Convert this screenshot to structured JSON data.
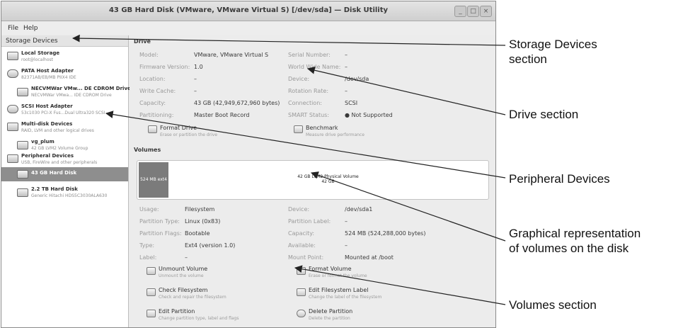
{
  "window": {
    "title": "43 GB Hard Disk (VMware, VMware Virtual S) [/dev/sda] — Disk Utility",
    "buttons": {
      "minimize": "_",
      "maximize": "□",
      "close": "×"
    }
  },
  "menubar": {
    "file": "File",
    "help": "Help"
  },
  "sidebar": {
    "header": "Storage Devices",
    "items": [
      {
        "title": "Local Storage",
        "subtitle": "root@localhost",
        "icon": "computer-icon"
      },
      {
        "title": "PATA Host Adapter",
        "subtitle": "82371AB/EB/MB PIIX4 IDE",
        "icon": "adapter-icon"
      },
      {
        "title": "NECVMWar VMw... DE CDROM Drive",
        "subtitle": "NECVMWar VMwa... IDE CDROM Drive",
        "icon": "optical-drive-icon"
      },
      {
        "title": "SCSI Host Adapter",
        "subtitle": "53c1030 PCI-X Fus...Dual Ultra320 SCSI",
        "icon": "adapter-icon"
      },
      {
        "title": "Multi-disk Devices",
        "subtitle": "RAID, LVM and other logical drives",
        "icon": "multidisk-icon"
      },
      {
        "title": "vg_plum",
        "subtitle": "42 GB LVM2 Volume Group",
        "icon": "volume-group-icon"
      },
      {
        "title": "Peripheral Devices",
        "subtitle": "USB, FireWire and other peripherals",
        "icon": "peripheral-icon"
      },
      {
        "title": "43 GB Hard Disk",
        "subtitle": "",
        "icon": "hard-disk-icon"
      },
      {
        "title": "2.2 TB Hard Disk",
        "subtitle": "Generic Hitachi HDS5C3030ALA630",
        "icon": "hard-disk-icon"
      }
    ]
  },
  "drive": {
    "heading": "Drive",
    "model_label": "Model:",
    "model": "VMware, VMware Virtual S",
    "firmware_label": "Firmware Version:",
    "firmware": "1.0",
    "location_label": "Location:",
    "location": "–",
    "write_cache_label": "Write Cache:",
    "write_cache": "–",
    "capacity_label": "Capacity:",
    "capacity": "43 GB (42,949,672,960 bytes)",
    "partitioning_label": "Partitioning:",
    "partitioning": "Master Boot Record",
    "serial_label": "Serial Number:",
    "serial": "–",
    "wwn_label": "World Wide Name:",
    "wwn": "–",
    "device_label": "Device:",
    "device": "/dev/sda",
    "rotation_label": "Rotation Rate:",
    "rotation": "–",
    "connection_label": "Connection:",
    "connection": "SCSI",
    "smart_label": "SMART Status:",
    "smart": "● Not Supported",
    "format_title": "Format Drive",
    "format_sub": "Erase or partition the drive",
    "bench_title": "Benchmark",
    "bench_sub": "Measure drive performance"
  },
  "volumes": {
    "heading": "Volumes",
    "seg1_label": "524 MB ext4",
    "seg2_line1": "42 GB LVM2 Physical Volume",
    "seg2_line2": "42 GB",
    "usage_label": "Usage:",
    "usage": "Filesystem",
    "ptype_label": "Partition Type:",
    "ptype": "Linux (0x83)",
    "pflags_label": "Partition Flags:",
    "pflags": "Bootable",
    "type_label": "Type:",
    "type": "Ext4 (version 1.0)",
    "label_label": "Label:",
    "label": "–",
    "device_label": "Device:",
    "device": "/dev/sda1",
    "plabel_label": "Partition Label:",
    "plabel": "–",
    "capacity_label": "Capacity:",
    "capacity": "524 MB (524,288,000 bytes)",
    "available_label": "Available:",
    "available": "–",
    "mount_label": "Mount Point:",
    "mount": "Mounted at /boot",
    "actions": {
      "unmount_title": "Unmount Volume",
      "unmount_sub": "Unmount the volume",
      "formatvol_title": "Format Volume",
      "formatvol_sub": "Erase or format the volume",
      "check_title": "Check Filesystem",
      "check_sub": "Check and repair the filesystem",
      "editlabel_title": "Edit Filesystem Label",
      "editlabel_sub": "Change the label of the filesystem",
      "editpart_title": "Edit Partition",
      "editpart_sub": "Change partition type, label and flags",
      "delete_title": "Delete Partition",
      "delete_sub": "Delete the partition"
    }
  },
  "callouts": {
    "storage_line1": "Storage Devices",
    "storage_line2": "section",
    "drive": "Drive section",
    "peripheral": "Peripheral Devices",
    "graphical_line1": "Graphical representation",
    "graphical_line2": "of volumes on the disk",
    "volumes": "Volumes section"
  }
}
